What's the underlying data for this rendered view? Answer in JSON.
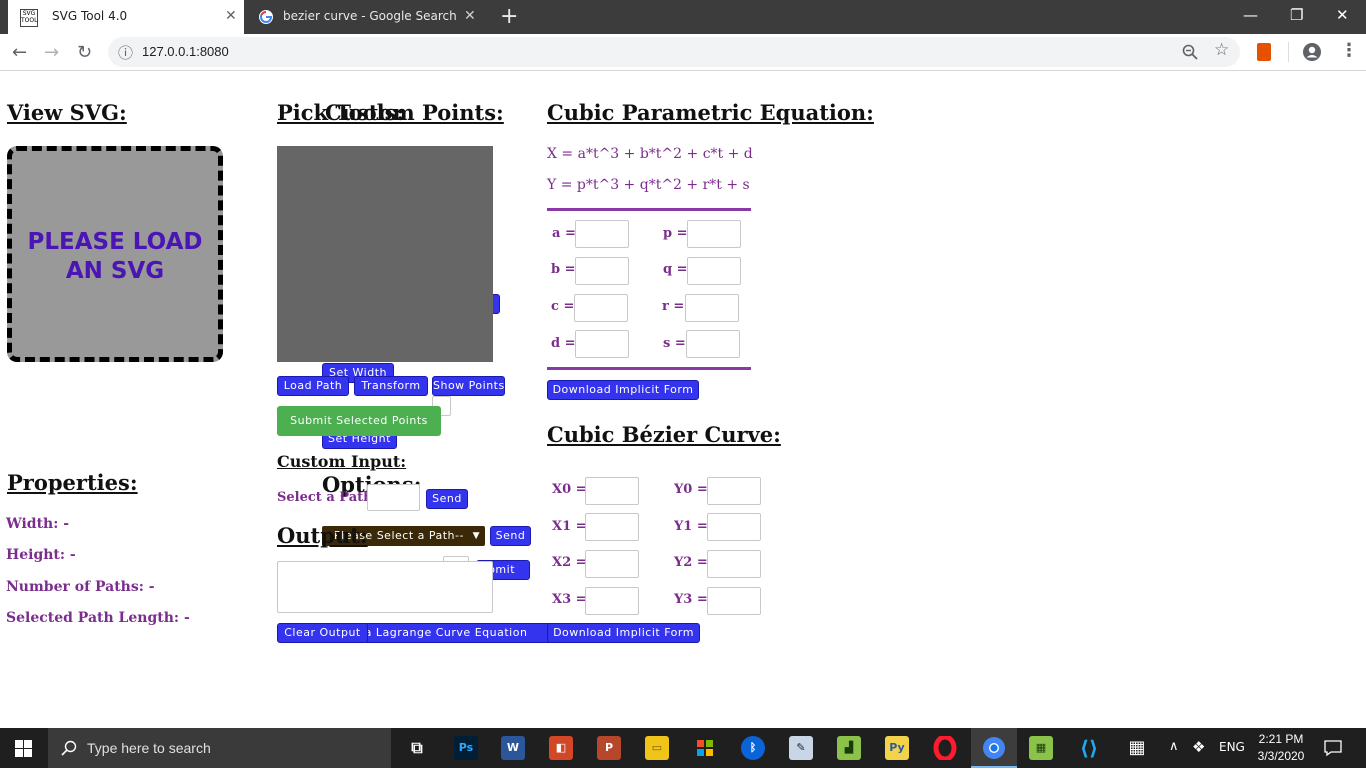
{
  "browser": {
    "tabs": [
      {
        "title": "SVG Tool 4.0",
        "icon": "svg-favicon"
      },
      {
        "title": "bezier curve - Google Search",
        "icon": "google-favicon"
      }
    ],
    "new_tab": "+",
    "url": "127.0.0.1:8080",
    "window_controls": {
      "minimize": "—",
      "restore": "❐",
      "close": "✕"
    },
    "nav": {
      "back": "←",
      "forward": "→",
      "reload": "↻",
      "info": "ⓘ"
    }
  },
  "view_svg": {
    "heading": "View SVG:",
    "placeholder_line1": "PLEASE LOAD",
    "placeholder_line2": "AN SVG"
  },
  "properties": {
    "heading": "Properties:",
    "width": "Width: -",
    "height": "Height: -",
    "paths": "Number of Paths: -",
    "selected_length": "Selected Path Length: -"
  },
  "tools": {
    "heading_pick": "Pick Tools:",
    "heading_custom_points": "Custom Points:",
    "set_width": "Set Width",
    "set_height": "Set Height",
    "load_path": "Load Path",
    "transform": "Transform",
    "show_points": "Show Points",
    "submit_selected": "Submit Selected Points",
    "custom_input_heading": "Custom Input:",
    "options_heading": "Options:",
    "select_path_label": "Select a Path:",
    "send": "Send",
    "select_placeholder": "Please Select a Path--",
    "send2": "Send",
    "output_heading": "Output:",
    "submit": "Submit",
    "clear_output": "Clear Output",
    "download_lagrange": "Download a Lagrange Curve Equation"
  },
  "parametric": {
    "heading": "Cubic Parametric Equation:",
    "eq_x": "X = a*t^3 + b*t^2 + c*t + d",
    "eq_y": "Y = p*t^3 + q*t^2 + r*t + s",
    "labels_left": [
      "a =",
      "b =",
      "c =",
      "d ="
    ],
    "labels_right": [
      "p =",
      "q =",
      "r =",
      "s ="
    ],
    "download": "Download Implicit Form"
  },
  "bezier": {
    "heading": "Cubic Bézier Curve:",
    "labels_left": [
      "X0 =",
      "X1 =",
      "X2 =",
      "X3 ="
    ],
    "labels_right": [
      "Y0 =",
      "Y1 =",
      "Y2 =",
      "Y3 ="
    ],
    "download": "Download Implicit Form"
  },
  "taskbar": {
    "search_placeholder": "Type here to search",
    "language": "ENG",
    "time": "2:21 PM",
    "date": "3/3/2020"
  }
}
